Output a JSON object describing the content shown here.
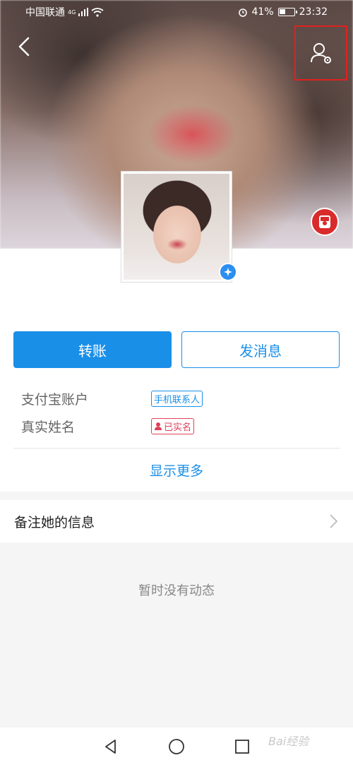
{
  "status_bar": {
    "carrier": "中国联通",
    "network": "4G",
    "battery": "41%",
    "time": "23:32"
  },
  "header": {
    "back_icon": "back-arrow-icon",
    "settings_icon": "user-settings-icon",
    "highlight_color": "#e02020",
    "fab_icon": "red-packet-icon"
  },
  "profile": {
    "nickname": "",
    "verified_icon": "verified-badge-icon"
  },
  "actions": {
    "transfer_label": "转账",
    "message_label": "发消息"
  },
  "info": {
    "rows": [
      {
        "label": "支付宝账户",
        "value": "",
        "tag": "手机联系人"
      },
      {
        "label": "真实姓名",
        "value": "",
        "tag": "已实名"
      }
    ]
  },
  "show_more": "显示更多",
  "remark": {
    "label": "备注她的信息"
  },
  "feed": {
    "empty_text": "暂时没有动态"
  },
  "nav": {
    "back_icon": "nav-back-icon",
    "home_icon": "nav-home-icon",
    "recent_icon": "nav-recent-icon"
  },
  "watermark": "Bai经验",
  "colors": {
    "accent": "#1a8fe8",
    "verified_tag": "#e0405a"
  }
}
